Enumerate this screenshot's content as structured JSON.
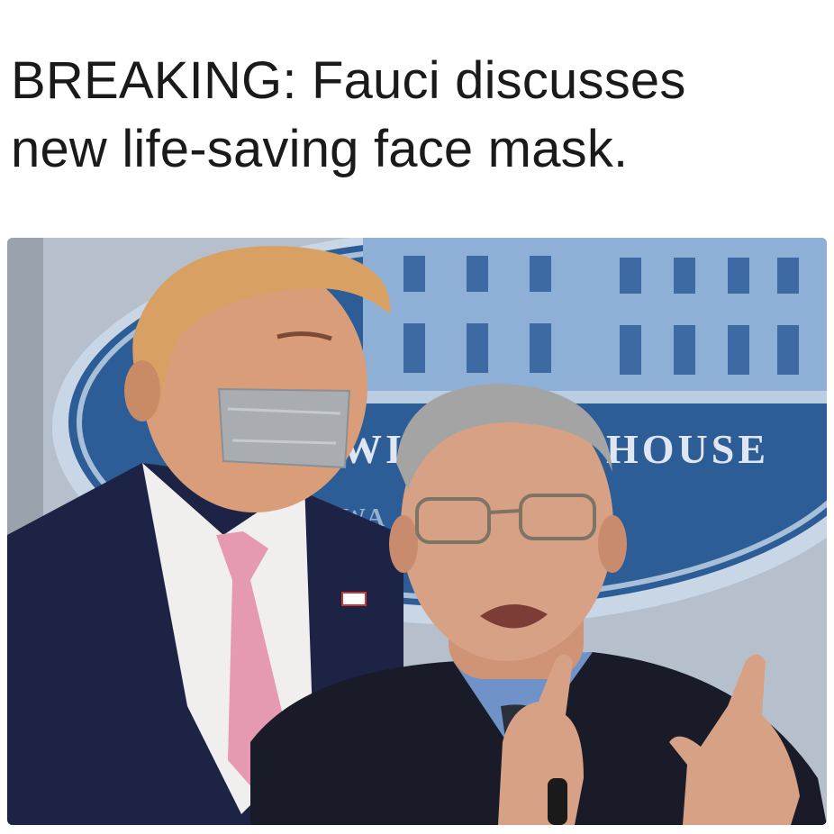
{
  "caption": {
    "line1": "BREAKING: Fauci discusses",
    "line2": "new life-saving face mask."
  },
  "photo": {
    "backdrop_text_left": "WI",
    "backdrop_text_right": "HOUSE",
    "backdrop_text_small": "WA",
    "colors": {
      "backdrop_blue": "#2d5d96",
      "backdrop_ring": "#a7bfd8",
      "suit_navy": "#1c2345",
      "tie_pink": "#e59ab1",
      "shirt_blue": "#6f93c8",
      "tape_gray": "#a9adb2",
      "skin": "#d99d7a"
    }
  }
}
